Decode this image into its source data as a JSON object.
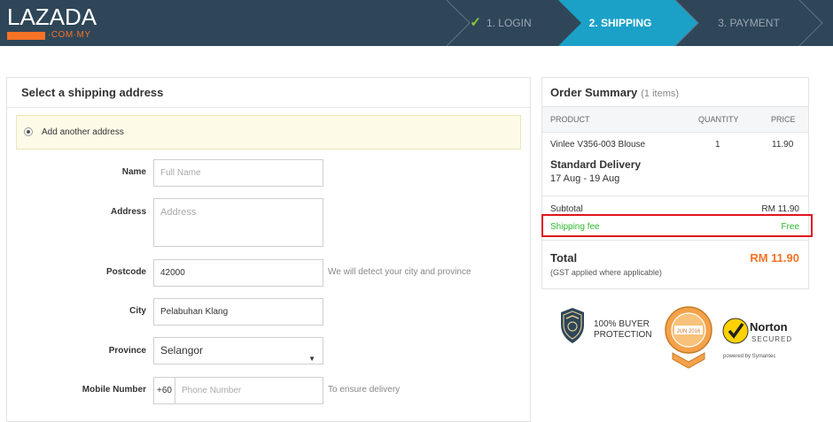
{
  "header": {
    "logo_word": "LAZADA",
    "logo_sub": "·COM·MY",
    "steps": {
      "login": "1. LOGIN",
      "shipping": "2. SHIPPING",
      "payment": "3. PAYMENT"
    }
  },
  "shipping_form": {
    "title": "Select a shipping address",
    "add_address": "Add another address",
    "name": {
      "label": "Name",
      "placeholder": "Full Name"
    },
    "address": {
      "label": "Address",
      "placeholder": "Address"
    },
    "postcode": {
      "label": "Postcode",
      "value": "42000",
      "hint": "We will detect your city and province"
    },
    "city": {
      "label": "City",
      "value": "Pelabuhan Klang"
    },
    "province": {
      "label": "Province",
      "value": "Selangor"
    },
    "mobile": {
      "label": "Mobile Number",
      "prefix": "+60",
      "placeholder": "Phone Number",
      "hint": "To ensure delivery"
    }
  },
  "order_summary": {
    "title": "Order Summary",
    "count": "(1 items)",
    "columns": {
      "product": "PRODUCT",
      "quantity": "QUANTITY",
      "price": "PRICE"
    },
    "item": {
      "name": "Vinlee V356-003 Blouse",
      "quantity": "1",
      "price": "11.90"
    },
    "delivery_type": "Standard Delivery",
    "delivery_dates": "17 Aug - 19 Aug",
    "subtotal_label": "Subtotal",
    "subtotal_value": "RM 11.90",
    "shipping_label": "Shipping fee",
    "shipping_value": "Free",
    "total_label": "Total",
    "total_note": "(GST applied where applicable)",
    "total_value": "RM 11.90"
  },
  "badges": {
    "protection_line1": "100% BUYER",
    "protection_line2": "PROTECTION",
    "seal_text": "JUN 2016",
    "norton_name": "Norton",
    "norton_secured": "SECURED",
    "norton_by": "powered by Symantec"
  },
  "colors": {
    "header_bg": "#2f4659",
    "active_step": "#1ba1c8",
    "accent_orange": "#f57224",
    "free_green": "#2eb82e",
    "highlight_red": "#e0141e"
  }
}
